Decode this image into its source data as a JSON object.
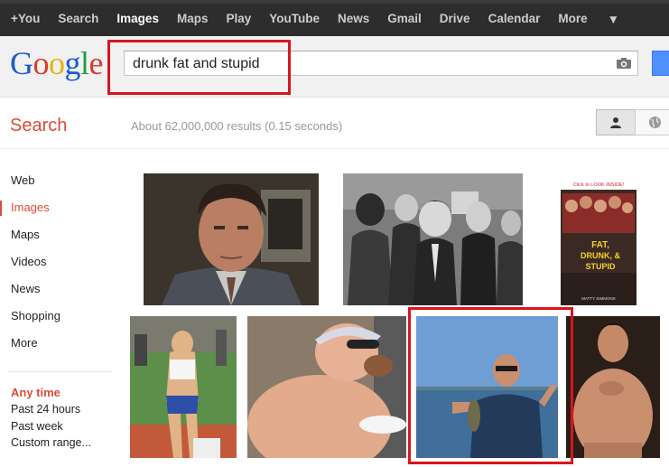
{
  "topnav": {
    "items": [
      {
        "label": "+You",
        "active": false
      },
      {
        "label": "Search",
        "active": false
      },
      {
        "label": "Images",
        "active": true
      },
      {
        "label": "Maps",
        "active": false
      },
      {
        "label": "Play",
        "active": false
      },
      {
        "label": "YouTube",
        "active": false
      },
      {
        "label": "News",
        "active": false
      },
      {
        "label": "Gmail",
        "active": false
      },
      {
        "label": "Drive",
        "active": false
      },
      {
        "label": "Calendar",
        "active": false
      },
      {
        "label": "More",
        "active": false
      }
    ]
  },
  "search": {
    "query": "drunk fat and stupid"
  },
  "subbar": {
    "title": "Search",
    "stats": "About 62,000,000 results (0.15 seconds)"
  },
  "leftnav": {
    "items": [
      {
        "label": "Web",
        "active": false
      },
      {
        "label": "Images",
        "active": true
      },
      {
        "label": "Maps",
        "active": false
      },
      {
        "label": "Videos",
        "active": false
      },
      {
        "label": "News",
        "active": false
      },
      {
        "label": "Shopping",
        "active": false
      },
      {
        "label": "More",
        "active": false
      }
    ]
  },
  "time_filter": {
    "heading": "Any time",
    "options": [
      "Past 24 hours",
      "Past week",
      "Custom range..."
    ]
  },
  "book_cover": {
    "tagline": "Click to LOOK INSIDE!",
    "title_line1": "FAT,",
    "title_line2": "DRUNK, &",
    "title_line3": "STUPID",
    "author": "MATTY SIMMONS"
  },
  "colors": {
    "accent_red": "#dd4b39",
    "highlight": "#d9151c",
    "topbar": "#2d2d2d",
    "link_blue": "#4d90fe"
  }
}
